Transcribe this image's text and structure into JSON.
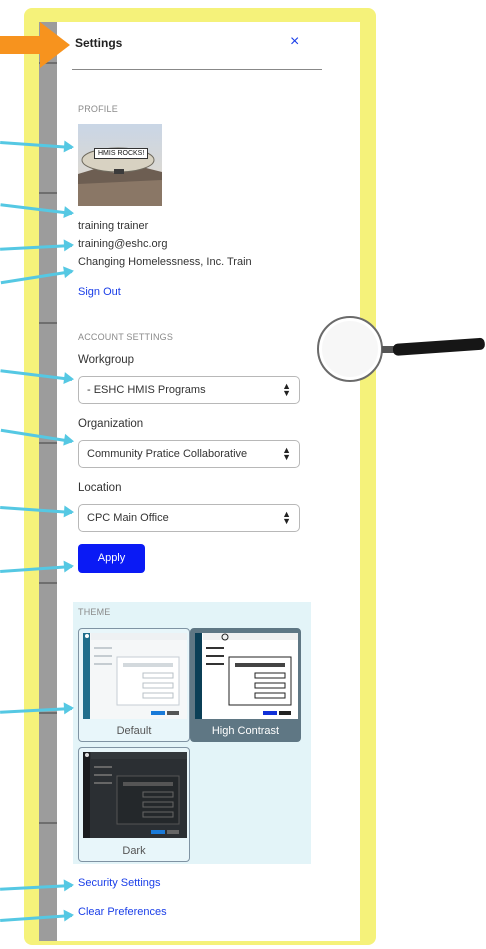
{
  "header": {
    "title": "Settings",
    "close_glyph": "×"
  },
  "profile": {
    "section_label": "PROFILE",
    "avatar_sign_text": "HMIS ROCKS!",
    "name": "training trainer",
    "email": "training@eshc.org",
    "org": "Changing Homelessness, Inc. Train",
    "sign_out": "Sign Out"
  },
  "account": {
    "section_label": "ACCOUNT SETTINGS",
    "workgroup_label": "Workgroup",
    "workgroup_value": "- ESHC HMIS Programs",
    "organization_label": "Organization",
    "organization_value": "Community Pratice Collaborative",
    "location_label": "Location",
    "location_value": "CPC Main Office",
    "apply_label": "Apply"
  },
  "theme": {
    "section_label": "THEME",
    "options": [
      {
        "label": "Default"
      },
      {
        "label": "High Contrast"
      },
      {
        "label": "Dark"
      }
    ],
    "colors": {
      "accent": "#0a1af5",
      "panel_bg": "#e3f4f8",
      "annotation": "#55c8e3",
      "frame": "#f5f27a",
      "callout": "#f7931e"
    }
  },
  "links": {
    "security": "Security Settings",
    "clear": "Clear Preferences"
  },
  "icons": [
    "close-icon",
    "caret-icon",
    "magnifier-icon",
    "arrow-icon"
  ]
}
